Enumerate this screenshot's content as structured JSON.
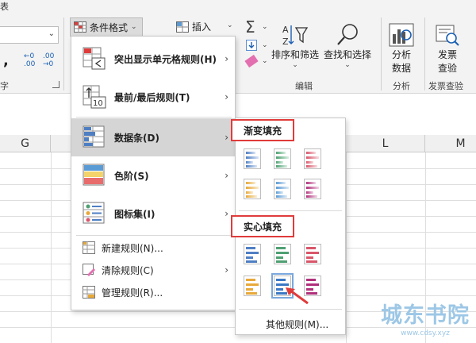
{
  "ribbon": {
    "top_left_char": "表",
    "font_group_label": "字",
    "conditional_format_label": "条件格式",
    "insert_label": "插入",
    "sort_filter_label": "排序和筛选",
    "find_select_label": "查找和选择",
    "analyze_label": "分析\n数据",
    "analyze_line1": "分析",
    "analyze_line2": "数据",
    "invoice_line1": "发票",
    "invoice_line2": "查验",
    "editing_group": "编辑",
    "analysis_group": "分析",
    "invoice_group": "发票查验",
    "dec_increase": "←0 .00",
    "dec_decrease": ".00 →0"
  },
  "columns": [
    "G",
    "L",
    "M"
  ],
  "menu": {
    "items": [
      {
        "label": "突出显示单元格规则(H)",
        "has_submenu": true
      },
      {
        "label": "最前/最后规则(T)",
        "has_submenu": true
      },
      {
        "label": "数据条(D)",
        "has_submenu": true
      },
      {
        "label": "色阶(S)",
        "has_submenu": true
      },
      {
        "label": "图标集(I)",
        "has_submenu": true
      }
    ],
    "small_items": [
      {
        "label": "新建规则(N)..."
      },
      {
        "label": "清除规则(C)"
      },
      {
        "label": "管理规则(R)..."
      }
    ],
    "icon_text_10": "10"
  },
  "submenu": {
    "gradient_heading": "渐变填充",
    "solid_heading": "实心填充",
    "more_rules": "其他规则(M)..."
  },
  "colors": {
    "blue": "#4f7fc3",
    "green": "#4fa072",
    "red": "#d9566a",
    "orange": "#e7a93a",
    "lightblue": "#5b9bd5",
    "purple": "#b0307a",
    "highlight_box": "#e03b3b"
  },
  "watermark": {
    "main": "城东书院",
    "sub": "www.cdsy.xyz"
  }
}
